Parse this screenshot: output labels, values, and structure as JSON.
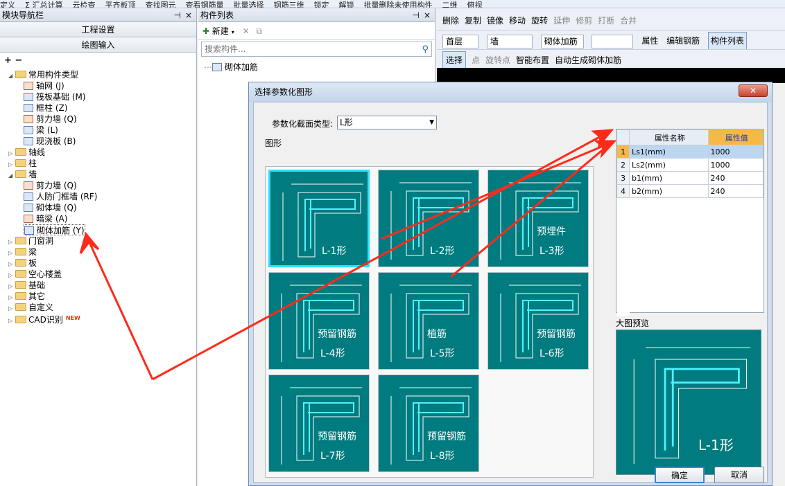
{
  "topbar": {
    "items": [
      "定义",
      "Σ 汇总计算",
      "云检查",
      "平齐板顶",
      "查找图元",
      "查看钢筋量",
      "批量选择",
      "钢筋三维",
      "锁定",
      "解锁",
      "批量删除未使用构件",
      "二维",
      "俯视"
    ]
  },
  "nav": {
    "title": "模块导航栏",
    "btn_settings": "工程设置",
    "btn_draw": "绘图输入",
    "tools": "+ −",
    "tree": [
      {
        "label": "常用构件类型",
        "level": 0,
        "toggle": "◢",
        "folder": true
      },
      {
        "label": "轴网 (J)",
        "level": 1
      },
      {
        "label": "筏板基础 (M)",
        "level": 1
      },
      {
        "label": "框柱 (Z)",
        "level": 1
      },
      {
        "label": "剪力墙 (Q)",
        "level": 1
      },
      {
        "label": "梁 (L)",
        "level": 1
      },
      {
        "label": "现浇板 (B)",
        "level": 1
      },
      {
        "label": "轴线",
        "level": 0,
        "toggle": "▷",
        "folder": true
      },
      {
        "label": "柱",
        "level": 0,
        "toggle": "▷",
        "folder": true
      },
      {
        "label": "墙",
        "level": 0,
        "toggle": "◢",
        "folder": true
      },
      {
        "label": "剪力墙 (Q)",
        "level": 1
      },
      {
        "label": "人防门框墙 (RF)",
        "level": 1
      },
      {
        "label": "砌体墙 (Q)",
        "level": 1
      },
      {
        "label": "暗梁 (A)",
        "level": 1
      },
      {
        "label": "砌体加筋 (Y)",
        "level": 1
      },
      {
        "label": "门窗洞",
        "level": 0,
        "toggle": "▷",
        "folder": true
      },
      {
        "label": "梁",
        "level": 0,
        "toggle": "▷",
        "folder": true
      },
      {
        "label": "板",
        "level": 0,
        "toggle": "▷",
        "folder": true
      },
      {
        "label": "空心楼盖",
        "level": 0,
        "toggle": "▷",
        "folder": true
      },
      {
        "label": "基础",
        "level": 0,
        "toggle": "▷",
        "folder": true
      },
      {
        "label": "其它",
        "level": 0,
        "toggle": "▷",
        "folder": true
      },
      {
        "label": "自定义",
        "level": 0,
        "toggle": "▷",
        "folder": true
      },
      {
        "label": "CAD识别",
        "level": 0,
        "toggle": "▷",
        "folder": true,
        "badge": "NEW"
      }
    ]
  },
  "comp": {
    "title": "构件列表",
    "new_label": "新建",
    "search_placeholder": "搜索构件...",
    "items": [
      "砌体加筋"
    ]
  },
  "right": {
    "row1": [
      "删除",
      "复制",
      "镜像",
      "移动",
      "旋转",
      "延伸",
      "修剪",
      "打断",
      "合并"
    ],
    "row2": {
      "floor": "首层",
      "cat": "墙",
      "sub": "砌体加筋",
      "attr": "属性",
      "edit": "编辑钢筋",
      "list": "构件列表"
    },
    "row3": [
      "选择",
      "点",
      "旋转点",
      "智能布置",
      "自动生成砌体加筋"
    ]
  },
  "dialog": {
    "title": "选择参数化图形",
    "type_label": "参数化截面类型:",
    "type_value": "L形",
    "gallery_label": "图形",
    "tiles": [
      {
        "name": "L-1形",
        "sub": ""
      },
      {
        "name": "L-2形",
        "sub": ""
      },
      {
        "name": "L-3形",
        "sub": "预埋件"
      },
      {
        "name": "L-4形",
        "sub": "预留钢筋"
      },
      {
        "name": "L-5形",
        "sub": "植筋"
      },
      {
        "name": "L-6形",
        "sub": "预留钢筋"
      },
      {
        "name": "L-7形",
        "sub": "预留钢筋"
      },
      {
        "name": "L-8形",
        "sub": "预留钢筋"
      }
    ],
    "props_header": [
      "属性名称",
      "属性值"
    ],
    "props": [
      {
        "n": "1",
        "name": "Ls1(mm)",
        "val": "1000"
      },
      {
        "n": "2",
        "name": "Ls2(mm)",
        "val": "1000"
      },
      {
        "n": "3",
        "name": "b1(mm)",
        "val": "240"
      },
      {
        "n": "4",
        "name": "b2(mm)",
        "val": "240"
      }
    ],
    "preview_label": "大图预览",
    "preview_name": "L-1形",
    "ok": "确定",
    "cancel": "取消"
  },
  "colors": {
    "teal": "#007b7f",
    "rebar": "#4ef3ff",
    "arrow": "#ff2a1a"
  }
}
